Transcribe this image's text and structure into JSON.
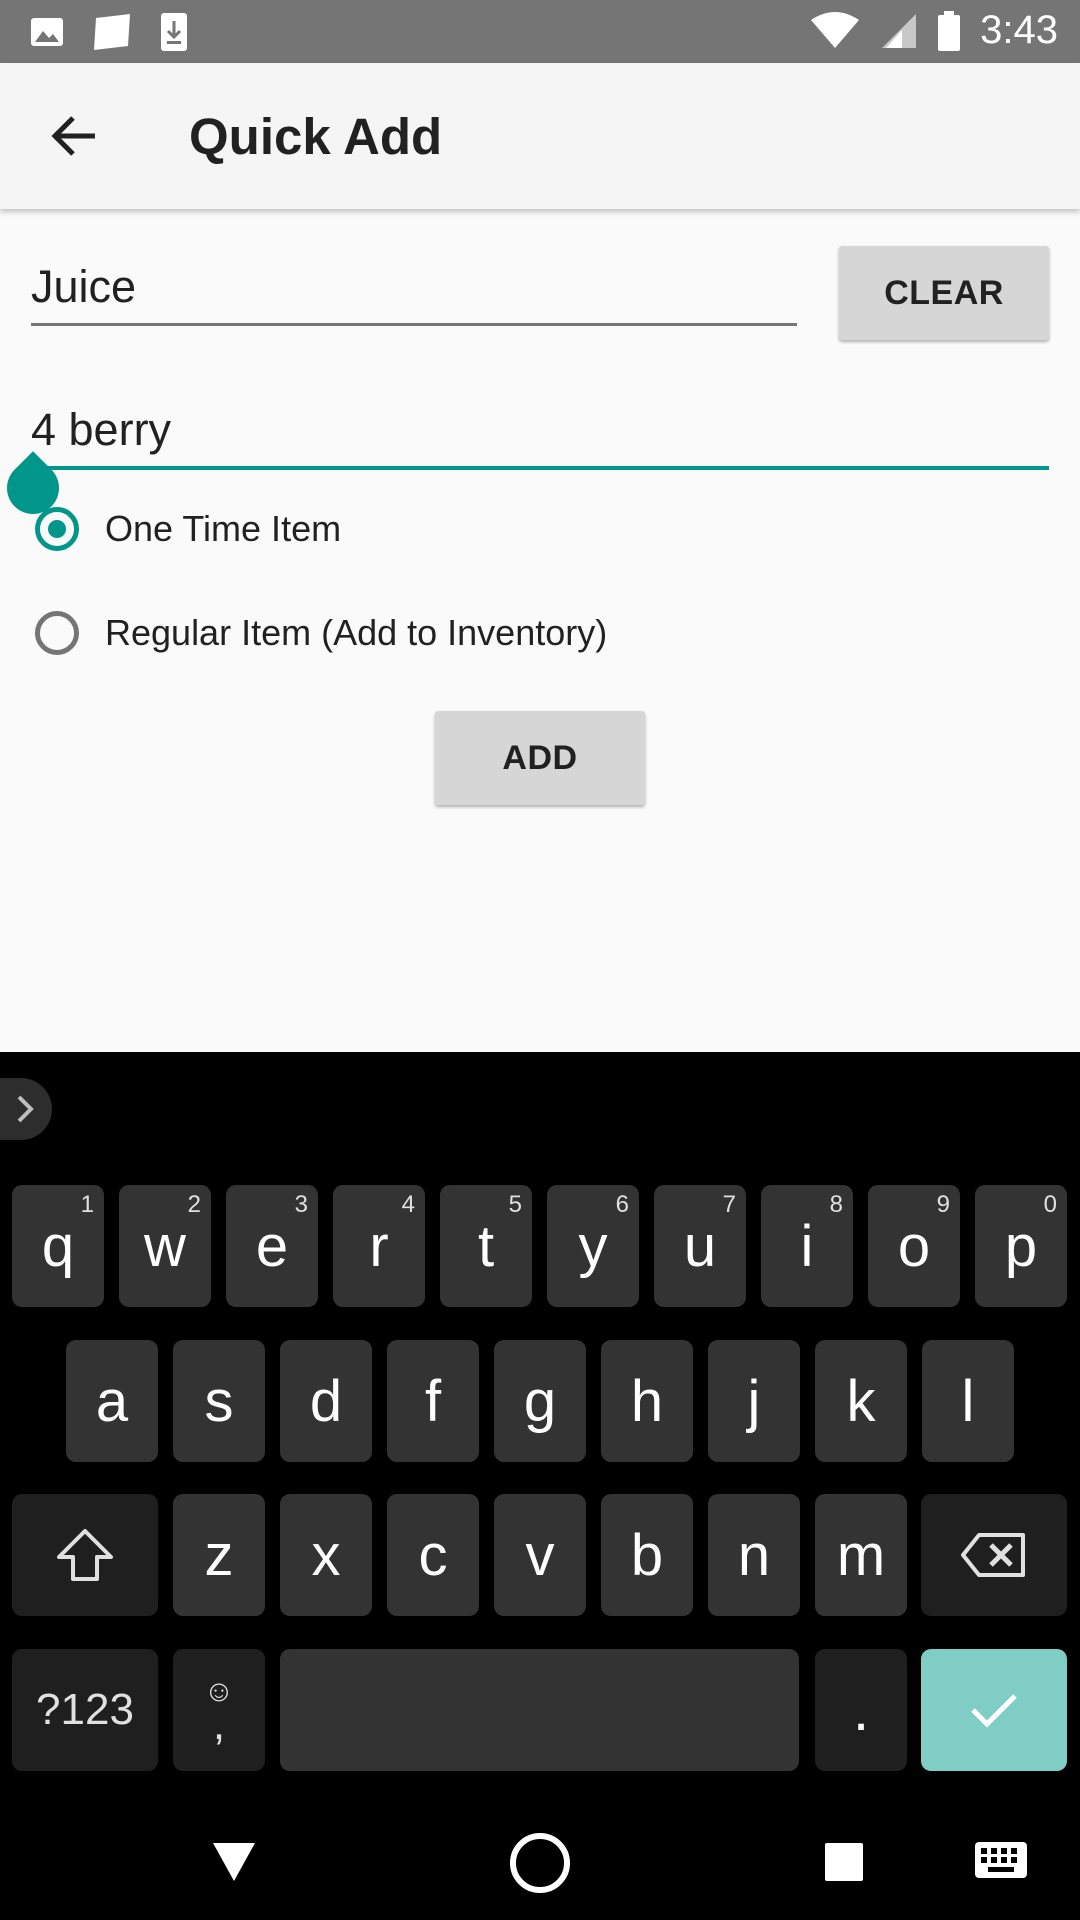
{
  "status_bar": {
    "time": "3:43",
    "left_icons": [
      "image-icon",
      "notification-card-icon",
      "download-icon"
    ],
    "right_icons": [
      "wifi-icon",
      "signal-icon",
      "battery-icon"
    ]
  },
  "app_bar": {
    "title": "Quick Add",
    "back_icon": "arrow-back-icon"
  },
  "form": {
    "item_name_value": "Juice",
    "clear_label": "CLEAR",
    "description_value": "4 berry",
    "radio_options": [
      {
        "label": "One Time Item",
        "checked": true
      },
      {
        "label": "Regular Item (Add to Inventory)",
        "checked": false
      }
    ],
    "add_label": "ADD"
  },
  "keyboard": {
    "row1": [
      {
        "key": "q",
        "hint": "1"
      },
      {
        "key": "w",
        "hint": "2"
      },
      {
        "key": "e",
        "hint": "3"
      },
      {
        "key": "r",
        "hint": "4"
      },
      {
        "key": "t",
        "hint": "5"
      },
      {
        "key": "y",
        "hint": "6"
      },
      {
        "key": "u",
        "hint": "7"
      },
      {
        "key": "i",
        "hint": "8"
      },
      {
        "key": "o",
        "hint": "9"
      },
      {
        "key": "p",
        "hint": "0"
      }
    ],
    "row2": [
      "a",
      "s",
      "d",
      "f",
      "g",
      "h",
      "j",
      "k",
      "l"
    ],
    "row3": [
      "z",
      "x",
      "c",
      "v",
      "b",
      "n",
      "m"
    ],
    "symbols_label": "?123",
    "comma_label": ",",
    "period_label": ".",
    "accent_color": "#00968a",
    "enter_color": "#7fcdc4"
  },
  "nav_bar": {
    "icons": [
      "back-triangle-icon",
      "home-circle-icon",
      "recents-square-icon",
      "keyboard-switch-icon"
    ]
  }
}
